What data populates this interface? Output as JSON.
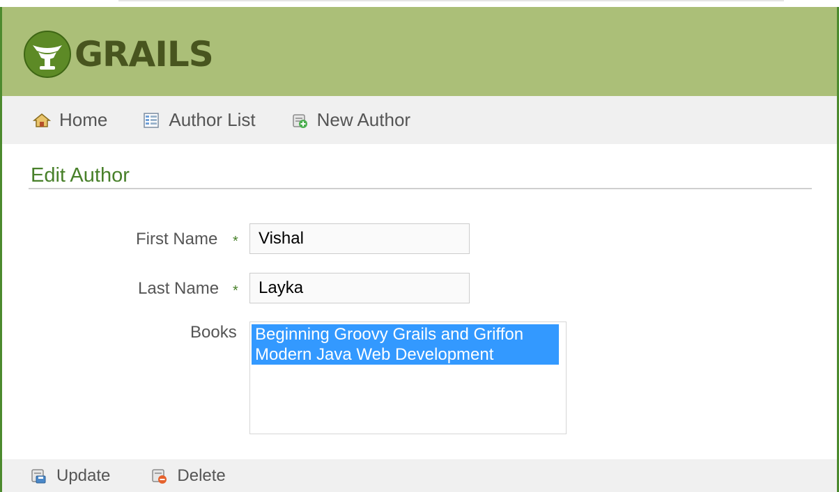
{
  "app": {
    "logo_text": "GRAILS"
  },
  "nav": {
    "items": [
      {
        "label": "Home",
        "icon": "home-icon"
      },
      {
        "label": "Author List",
        "icon": "list-icon"
      },
      {
        "label": "New Author",
        "icon": "new-icon"
      }
    ]
  },
  "page": {
    "title": "Edit Author"
  },
  "form": {
    "first_name": {
      "label": "First Name",
      "required_marker": "*",
      "value": "Vishal"
    },
    "last_name": {
      "label": "Last Name",
      "required_marker": "*",
      "value": "Layka"
    },
    "books": {
      "label": "Books",
      "options": [
        {
          "label": "Beginning Groovy Grails and Griffon",
          "selected": true
        },
        {
          "label": "Modern Java Web Development",
          "selected": true
        }
      ]
    }
  },
  "buttons": {
    "update_label": "Update",
    "delete_label": "Delete"
  },
  "colors": {
    "header_bg": "#abbf78",
    "accent_green": "#48802a",
    "selection_blue": "#3399ff"
  }
}
